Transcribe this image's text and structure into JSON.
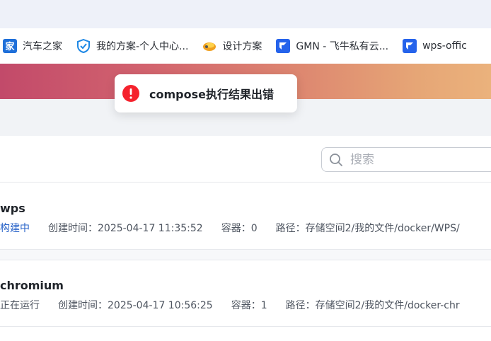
{
  "bookmarks": [
    {
      "label": "汽车之家",
      "icon": "autohome-icon"
    },
    {
      "label": "我的方案-个人中心...",
      "icon": "shield-check-icon"
    },
    {
      "label": "设计方案",
      "icon": "design-icon"
    },
    {
      "label": "GMN - 飞牛私有云...",
      "icon": "fnos-icon"
    },
    {
      "label": "wps-offic",
      "icon": "fnos-icon"
    }
  ],
  "toast": {
    "message": "compose执行结果出错",
    "icon": "error-circle-icon",
    "color": "#f5222d"
  },
  "search": {
    "placeholder": "搜索"
  },
  "projects": [
    {
      "name": "wps",
      "status": "构建中",
      "created": "创建时间：2025-04-17 11:35:52",
      "containers": "容器：0",
      "path": "路径：存储空间2/我的文件/docker/WPS/"
    },
    {
      "name": "chromium",
      "status": "正在运行",
      "created": "创建时间：2025-04-17 10:56:25",
      "containers": "容器：1",
      "path": "路径：存储空间2/我的文件/docker-chr"
    }
  ]
}
